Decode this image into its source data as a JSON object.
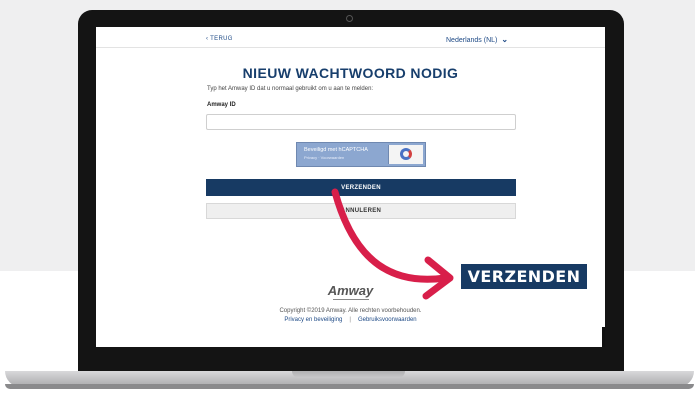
{
  "header": {
    "back_label": "TERUG",
    "language": "Nederlands (NL)"
  },
  "form": {
    "title": "NIEUW WACHTWOORD NODIG",
    "instructions": "Typ het Amway ID dat u normaal gebruikt om u aan te melden:",
    "id_label": "Amway ID",
    "id_value": "",
    "captcha_label": "Beveiligd met hCAPTCHA",
    "captcha_sub": "Privacy · Voorwaarden",
    "submit_label": "VERZENDEN",
    "cancel_label": "ANNULEREN"
  },
  "footer": {
    "logo_text": "Amway",
    "copyright": "Copyright ©2019 Amway. Alle rechten voorbehouden.",
    "privacy_link": "Privacy en beveiliging",
    "separator": "|",
    "terms_link": "Gebruiksvoorwaarden"
  },
  "callout": {
    "label": "VERZENDEN"
  },
  "colors": {
    "brand_navy": "#173a63",
    "link_blue": "#1e4a86",
    "arrow_red": "#d81f4a"
  },
  "icons": {
    "back": "chevron-left-icon",
    "language": "chevron-down-icon",
    "captcha": "captcha-logo-icon",
    "arrow": "curved-arrow-icon"
  }
}
